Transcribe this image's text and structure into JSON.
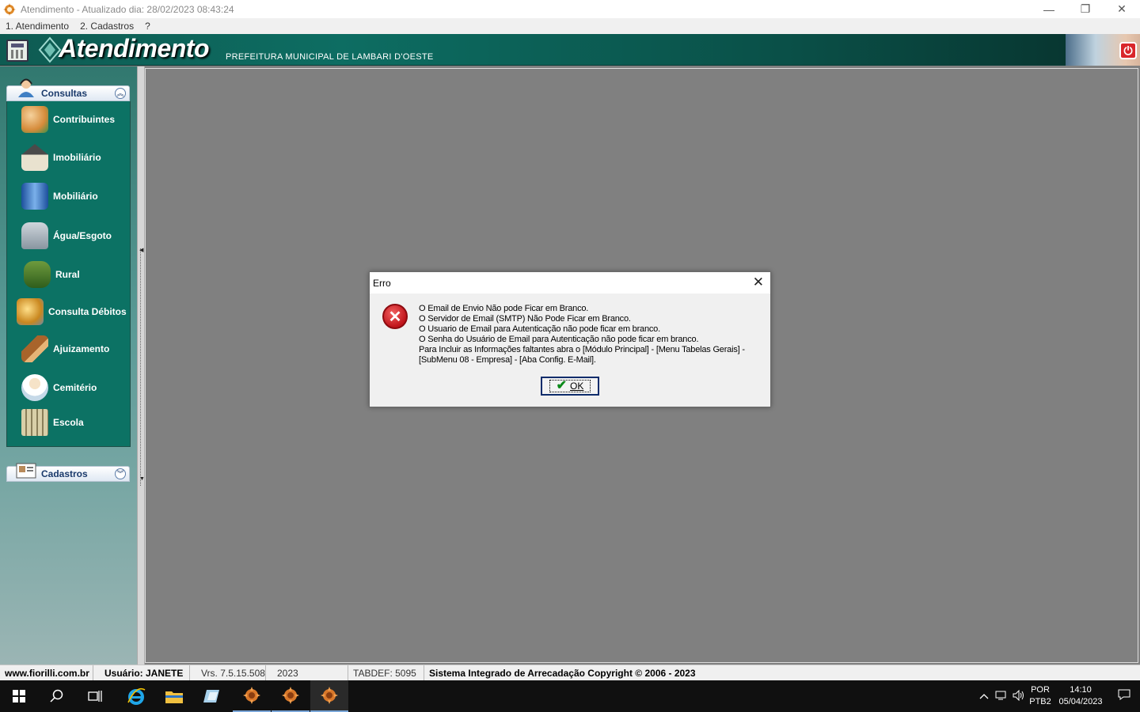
{
  "window": {
    "title": "Atendimento - Atualizado dia: 28/02/2023 08:43:24",
    "minimize": "—",
    "restore": "❐",
    "close": "✕"
  },
  "menu": {
    "items": [
      "1. Atendimento",
      "2. Cadastros",
      "?"
    ]
  },
  "banner": {
    "brand": "Atendimento",
    "subtitle": "PREFEITURA MUNICIPAL DE LAMBARI D'OESTE",
    "power_icon": "⏻"
  },
  "sidebar": {
    "consultas_header": "Consultas",
    "consultas_chevron": "︽",
    "items": [
      {
        "label": "Contribuintes",
        "icon": "people-icon"
      },
      {
        "label": "Imobiliário",
        "icon": "house-icon"
      },
      {
        "label": "Mobiliário",
        "icon": "building-icon"
      },
      {
        "label": "Água/Esgoto",
        "icon": "faucet-icon"
      },
      {
        "label": "Rural",
        "icon": "tractor-icon"
      },
      {
        "label": "Consulta Débitos",
        "icon": "debts-icon"
      },
      {
        "label": "Ajuizamento",
        "icon": "gavel-icon"
      },
      {
        "label": "Cemitério",
        "icon": "angel-icon"
      },
      {
        "label": "Escola",
        "icon": "school-icon"
      }
    ],
    "cadastros_header": "Cadastros",
    "cadastros_chevron": "︾"
  },
  "dialog": {
    "title": "Erro",
    "close": "✕",
    "icon": "✕",
    "lines": [
      "O Email de Envio Não pode Ficar em Branco.",
      "O Servidor de Email (SMTP) Não Pode Ficar em Branco.",
      "O Usuario de Email para Autenticação não pode ficar em branco.",
      "O Senha do Usuário de Email para Autenticação não pode ficar em branco.",
      "Para Incluir as Informações faltantes abra o [Módulo Principal] - [Menu Tabelas Gerais] -",
      "[SubMenu 08 - Empresa] - [Aba Config. E-Mail]."
    ],
    "ok_check": "✔",
    "ok_label": "OK"
  },
  "status": {
    "site": "www.fiorilli.com.br",
    "user": "Usuário: JANETE",
    "version": "Vrs. 7.5.15.508",
    "year": "2023",
    "tabdef": "TABDEF: 5095",
    "copyright": "Sistema Integrado de Arrecadação Copyright © 2006 - 2023"
  },
  "taskbar": {
    "lang_top": "POR",
    "lang_bottom": "PTB2",
    "time": "14:10",
    "date": "05/04/2023"
  },
  "colors": {
    "banner": "#0d6d62",
    "sidebar_group": "#0c7264",
    "error_red": "#c0141b",
    "taskbar": "#101010"
  }
}
